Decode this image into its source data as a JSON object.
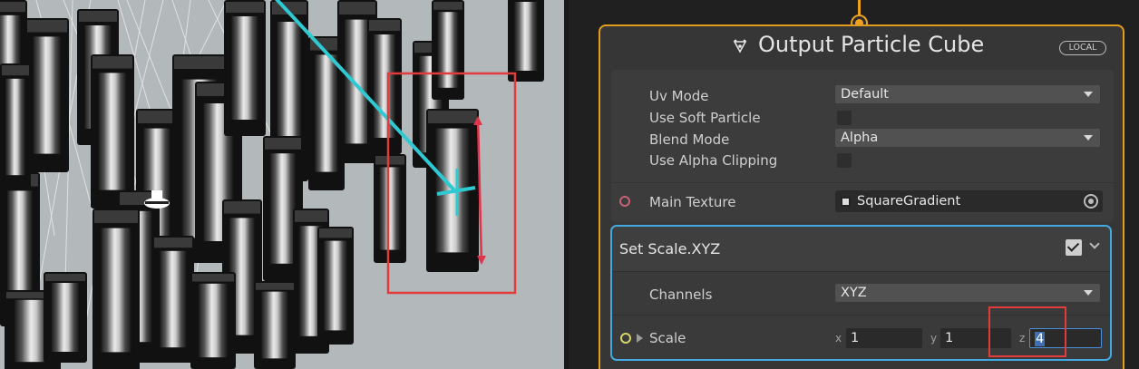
{
  "node": {
    "title": "Output Particle Cube",
    "badge": "LOCAL",
    "settings": [
      {
        "label": "Uv Mode",
        "type": "dropdown",
        "value": "Default"
      },
      {
        "label": "Use Soft Particle",
        "type": "checkbox",
        "checked": false
      },
      {
        "label": "Blend Mode",
        "type": "dropdown",
        "value": "Alpha"
      },
      {
        "label": "Use Alpha Clipping",
        "type": "checkbox",
        "checked": false
      }
    ],
    "main_texture": {
      "label": "Main Texture",
      "value": "SquareGradient"
    }
  },
  "block": {
    "title": "Set Scale.XYZ",
    "enabled": true,
    "channels": {
      "label": "Channels",
      "value": "XYZ"
    },
    "scale": {
      "label": "Scale",
      "x_label": "x",
      "x": "1",
      "y_label": "y",
      "y": "1",
      "z_label": "z",
      "z": "4"
    }
  },
  "colors": {
    "node_border": "#e39d1d",
    "block_border": "#43a9e0",
    "highlight_red": "#e23b3b",
    "gizmo_cyan": "#2fc9d2",
    "gizmo_red": "#e0344a"
  },
  "icons": [
    "particle-output-icon",
    "texture-thumb-icon",
    "object-picker-icon",
    "checkmark-icon",
    "chevron-down-icon",
    "expander-arrow-icon"
  ]
}
